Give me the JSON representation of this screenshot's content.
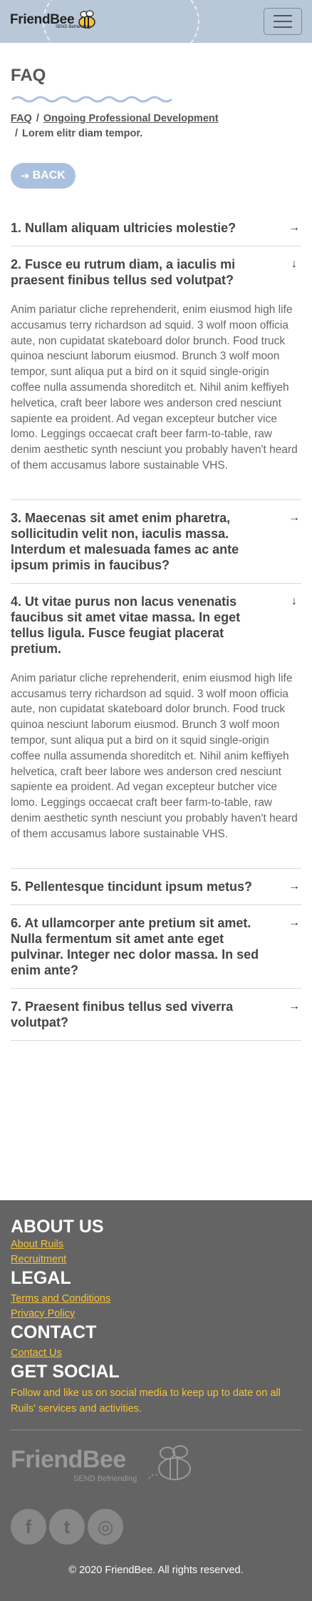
{
  "header": {
    "logo_friend": "Friend",
    "logo_bee": "Bee",
    "logo_sub": "SEND Befriending"
  },
  "page": {
    "title": "FAQ",
    "breadcrumb": [
      "FAQ",
      "Ongoing Professional Development",
      "Lorem elitr diam tempor."
    ],
    "back_label": "BACK"
  },
  "faqs": [
    {
      "question": "1. Nullam aliquam ultricies molestie?",
      "expanded": false
    },
    {
      "question": "2. Fusce eu rutrum diam, a iaculis mi praesent finibus tellus sed volutpat?",
      "expanded": true,
      "answer": "Anim pariatur cliche reprehenderit, enim eiusmod high life accusamus terry richardson ad squid. 3 wolf moon officia aute, non cupidatat skateboard dolor brunch. Food truck quinoa nesciunt laborum eiusmod. Brunch 3 wolf moon tempor, sunt aliqua put a bird on it squid single-origin coffee nulla assumenda shoreditch et. Nihil anim keffiyeh helvetica, craft beer labore wes anderson cred nesciunt sapiente ea proident. Ad vegan excepteur butcher vice lomo. Leggings occaecat craft beer farm-to-table, raw denim aesthetic synth nesciunt you probably haven't heard of them accusamus labore sustainable VHS."
    },
    {
      "question": "3. Maecenas sit amet enim pharetra, sollicitudin velit non, iaculis massa. Interdum et malesuada fames ac ante ipsum primis in faucibus?",
      "expanded": false
    },
    {
      "question": "4. Ut vitae purus non lacus venenatis faucibus sit amet vitae massa. In eget tellus ligula. Fusce feugiat placerat pretium.",
      "expanded": true,
      "answer": "Anim pariatur cliche reprehenderit, enim eiusmod high life accusamus terry richardson ad squid. 3 wolf moon officia aute, non cupidatat skateboard dolor brunch. Food truck quinoa nesciunt laborum eiusmod. Brunch 3 wolf moon tempor, sunt aliqua put a bird on it squid single-origin coffee nulla assumenda shoreditch et. Nihil anim keffiyeh helvetica, craft beer labore wes anderson cred nesciunt sapiente ea proident. Ad vegan excepteur butcher vice lomo. Leggings occaecat craft beer farm-to-table, raw denim aesthetic synth nesciunt you probably haven't heard of them accusamus labore sustainable VHS."
    },
    {
      "question": "5. Pellentesque tincidunt ipsum metus?",
      "expanded": false
    },
    {
      "question": "6. At ullamcorper ante pretium sit amet. Nulla fermentum sit amet ante eget pulvinar. Integer nec dolor massa. In sed enim ante?",
      "expanded": false
    },
    {
      "question": "7. Praesent finibus tellus sed viverra volutpat?",
      "expanded": false
    }
  ],
  "footer": {
    "about_heading": "ABOUT US",
    "about_links": [
      "About Ruils",
      "Recruitment"
    ],
    "legal_heading": "LEGAL",
    "legal_links": [
      "Terms and Conditions",
      "Privacy Policy"
    ],
    "contact_heading": "CONTACT",
    "contact_links": [
      "Contact Us"
    ],
    "social_heading": "GET SOCIAL",
    "social_text": "Follow and like us on social media to keep up to date on all Ruils' services and activities.",
    "logo_friend": "Friend",
    "logo_bee": "Bee",
    "logo_sub": "SEND Befriending",
    "socials": [
      {
        "name": "facebook-icon",
        "glyph": "f"
      },
      {
        "name": "twitter-icon",
        "glyph": "t"
      },
      {
        "name": "instagram-icon",
        "glyph": "◎"
      }
    ],
    "copyright": "© 2020 FriendBee. All rights reserved."
  },
  "colors": {
    "header_bg": "#b9c8d8",
    "back_button": "#a9c1de",
    "footer_bg": "#646464",
    "footer_link": "#f6c33a"
  }
}
